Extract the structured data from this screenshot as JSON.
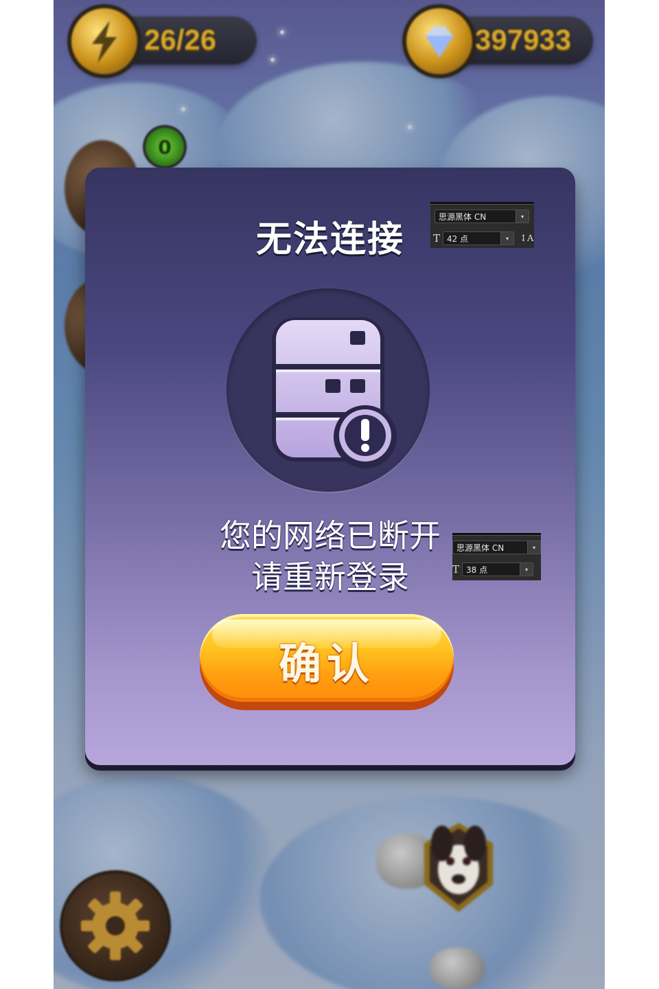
{
  "hud": {
    "energy": "26/26",
    "gems": "397933"
  },
  "dialog": {
    "title": "无法连接",
    "message_line1": "您的网络已断开",
    "message_line2": "请重新登录",
    "confirm_label": "确认"
  },
  "annotations": {
    "title_panel": {
      "font_name": "思源黑体 CN",
      "font_size": "42 点"
    },
    "message_panel": {
      "font_name": "思源黑体 CN",
      "font_size": "38 点"
    }
  },
  "icons": {
    "energy": "lightning-icon",
    "gems": "diamond-icon",
    "server": "server-warning-icon",
    "settings": "gear-icon"
  },
  "colors": {
    "dialog_top": "#363561",
    "dialog_bottom": "#b7a6dc",
    "button_top": "#ffe05a",
    "button_bottom": "#ff8a0a"
  }
}
